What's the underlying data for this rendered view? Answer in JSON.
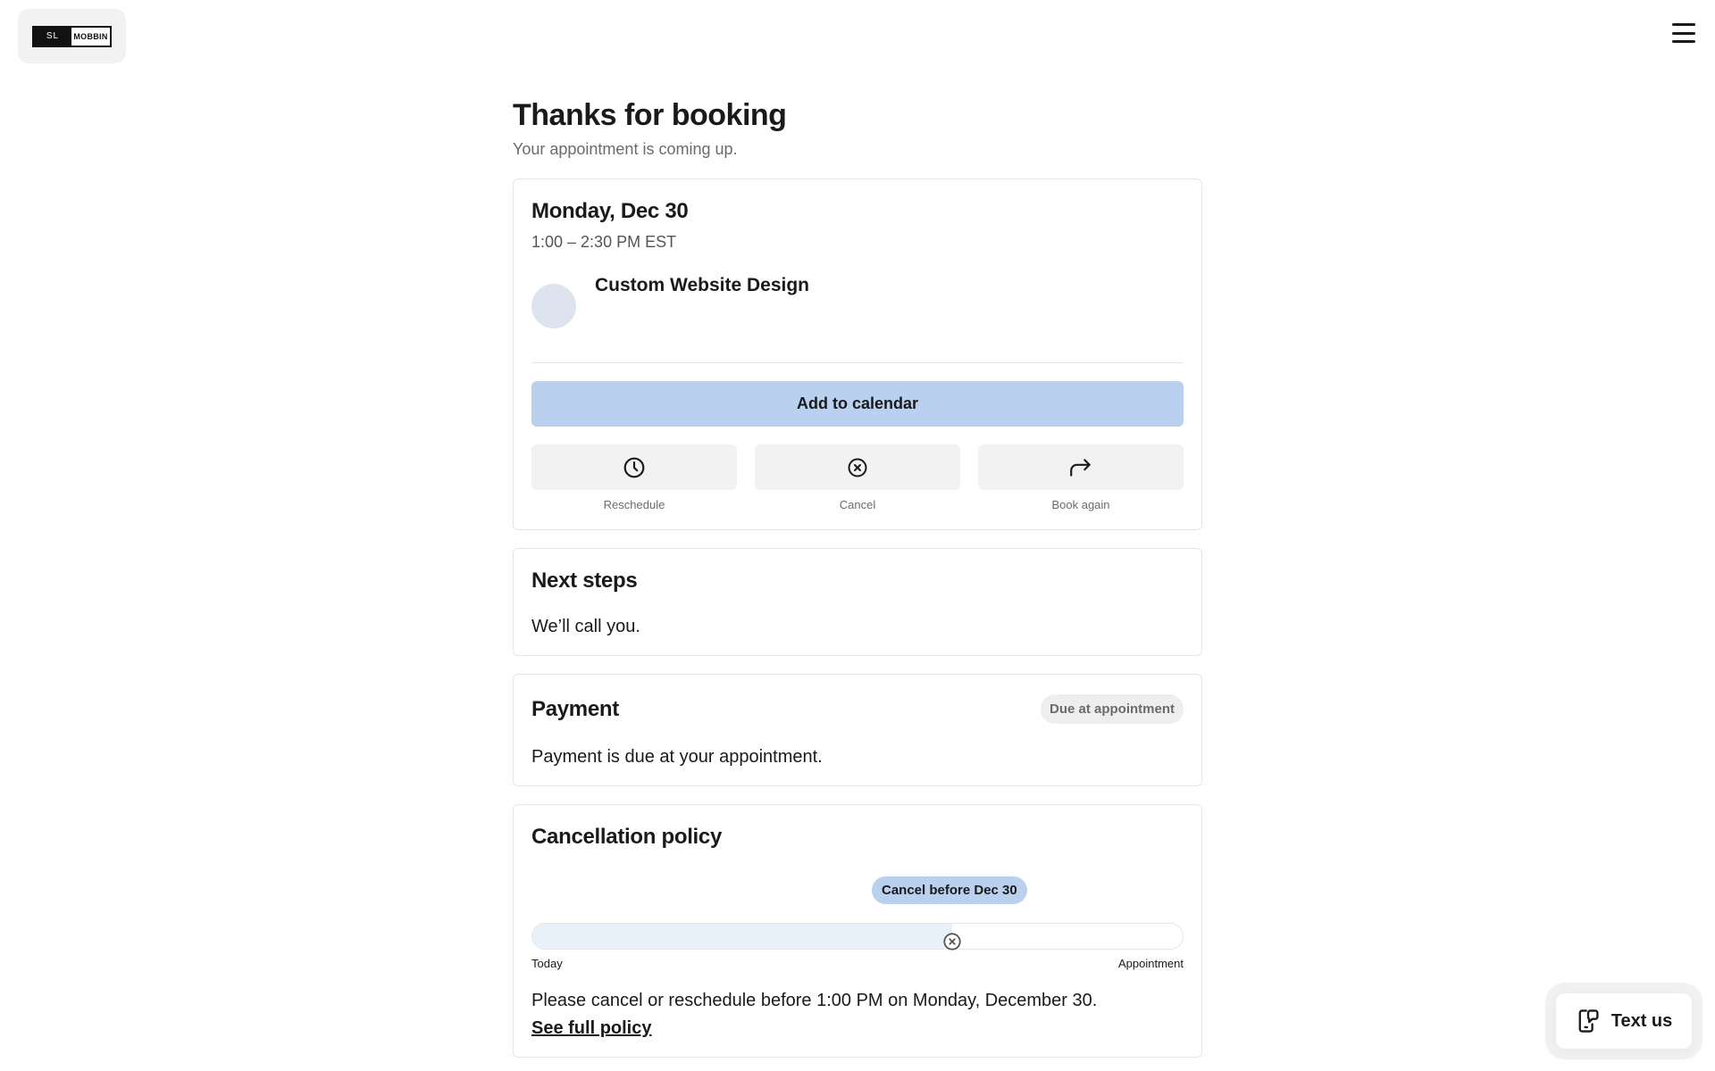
{
  "brand": {
    "logo_left": "SL",
    "logo_right": "MOBBIN"
  },
  "header": {
    "title": "Thanks for booking",
    "subtitle": "Your appointment is coming up."
  },
  "appointment": {
    "date": "Monday, Dec 30",
    "time": "1:00 – 2:30 PM EST",
    "service": "Custom Website Design",
    "add_to_calendar": "Add to calendar",
    "actions": [
      {
        "label": "Reschedule",
        "icon": "clock-icon"
      },
      {
        "label": "Cancel",
        "icon": "x-circle-icon"
      },
      {
        "label": "Book again",
        "icon": "redo-arrow-icon"
      }
    ]
  },
  "next_steps": {
    "title": "Next steps",
    "text": "We’ll call you."
  },
  "payment": {
    "title": "Payment",
    "badge": "Due at appointment",
    "text": "Payment is due at your appointment."
  },
  "cancellation": {
    "title": "Cancellation policy",
    "badge": "Cancel before Dec 30",
    "track_start": "Today",
    "track_end": "Appointment",
    "deadline_fraction": 0.645,
    "text": "Please cancel or reschedule before 1:00 PM on Monday, December 30.",
    "link": "See full policy"
  },
  "text_us": {
    "label": "Text us"
  },
  "colors": {
    "accent": "#b9d0ee",
    "track_fill": "#e8f0fa",
    "neutral_button": "#f2f2f2"
  }
}
